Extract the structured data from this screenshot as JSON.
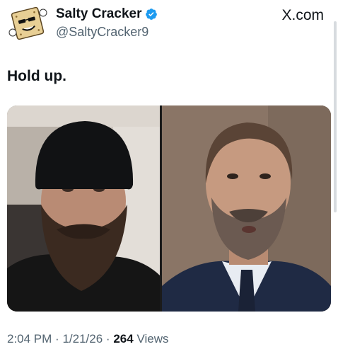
{
  "author": {
    "display_name": "Salty Cracker",
    "handle": "@SaltyCracker9",
    "verified_icon": "verified-badge-icon",
    "avatar_icon": "cracker-cartoon-avatar"
  },
  "site_label": "X.com",
  "tweet": {
    "text": "Hold up."
  },
  "media": {
    "left_photo": "man-in-black-beanie-with-beard",
    "right_photo": "man-in-suit-with-gray-beard"
  },
  "meta": {
    "time": "2:04 PM",
    "separator": "·",
    "date": "1/21/26",
    "views_count": "264",
    "views_label": "Views"
  },
  "colors": {
    "text": "#0f1419",
    "secondary": "#536471",
    "verified": "#1d9bf0"
  }
}
